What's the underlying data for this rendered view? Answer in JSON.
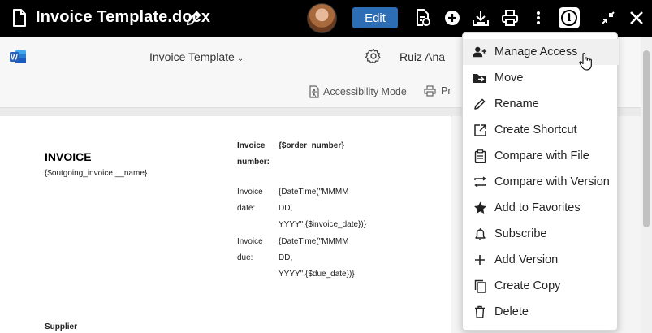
{
  "header": {
    "doc_title": "Invoice Template.docx",
    "edit_label": "Edit"
  },
  "ribbon": {
    "doc_name": "Invoice Template",
    "user_name": "Ruiz Ana",
    "accessibility_mode": "Accessibility Mode",
    "print_partial": "Pr"
  },
  "document": {
    "title": "INVOICE",
    "subtitle": "{$outgoing_invoice.__name}",
    "invoice_number_label_1": "Invoice",
    "invoice_number_label_2": "number:",
    "invoice_number_value": "{$order_number}",
    "invoice_date_label_1": "Invoice",
    "invoice_date_label_2": "date:",
    "invoice_date_value_1": "{DateTime(\"MMMM",
    "invoice_date_value_2": "DD,",
    "invoice_date_value_3": "YYYY\",{$invoice_date})}",
    "invoice_due_label_1": "Invoice",
    "invoice_due_label_2": "due:",
    "invoice_due_value_1": "{DateTime(\"MMMM",
    "invoice_due_value_2": "DD,",
    "invoice_due_value_3": "YYYY\",{$due_date})}",
    "supplier": "Supplier"
  },
  "menu": {
    "items": [
      {
        "label": "Manage Access",
        "icon": "user-plus-icon"
      },
      {
        "label": "Move",
        "icon": "folder-move-icon"
      },
      {
        "label": "Rename",
        "icon": "pencil-icon"
      },
      {
        "label": "Create Shortcut",
        "icon": "shortcut-icon"
      },
      {
        "label": "Compare with File",
        "icon": "clipboard-icon"
      },
      {
        "label": "Compare with Version",
        "icon": "compare-arrows-icon"
      },
      {
        "label": "Add to Favorites",
        "icon": "star-icon"
      },
      {
        "label": "Subscribe",
        "icon": "bell-icon"
      },
      {
        "label": "Add Version",
        "icon": "plus-icon"
      },
      {
        "label": "Create Copy",
        "icon": "copy-icon"
      },
      {
        "label": "Delete",
        "icon": "trash-icon"
      }
    ]
  },
  "colors": {
    "topbar": "#000000",
    "edit_button": "#2d6db3",
    "word_blue": "#2b5eb7"
  }
}
